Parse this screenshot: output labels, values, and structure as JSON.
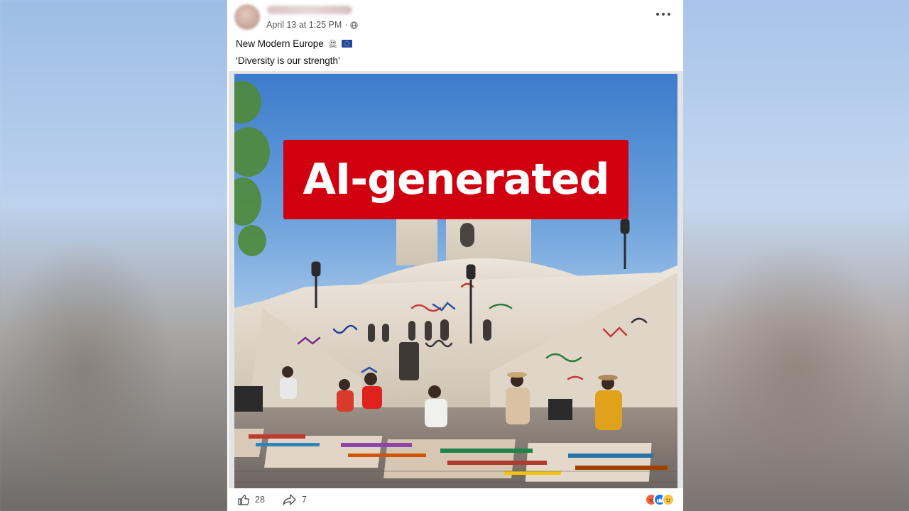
{
  "post": {
    "author_name": "",
    "timestamp": "April 13 at 1:25 PM",
    "separator": "·",
    "caption_line1": "New Modern Europe",
    "caption_line1_emojis": [
      "skull-crossbones-emoji",
      "eu-flag-emoji"
    ],
    "caption_line2": "‘Diversity is our strength’",
    "overlay_label": "AI-generated",
    "like_count": "28",
    "share_count": "7",
    "reactions": [
      "angry",
      "like",
      "sad"
    ]
  },
  "colors": {
    "overlay_red": "#d10010",
    "like_blue": "#1877f2"
  },
  "icons": {
    "globe": "globe-icon",
    "more": "more-options-icon",
    "like": "thumbs-up-icon",
    "share": "share-arrow-icon"
  }
}
